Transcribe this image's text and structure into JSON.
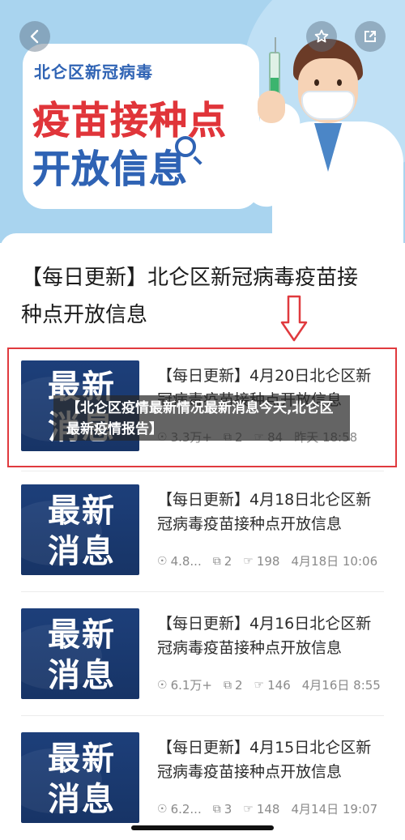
{
  "banner": {
    "subtitle": "北仑区新冠病毒",
    "headline_line1": "疫苗接种点",
    "headline_line2": "开放信息",
    "colors": {
      "background": "#a9d4ef",
      "red": "#e0353a",
      "blue": "#2f63b4"
    }
  },
  "nav": {
    "back_icon": "chevron-left-icon",
    "favorite_icon": "star-icon",
    "share_icon": "share-icon"
  },
  "article": {
    "title": "【每日更新】北仑区新冠病毒疫苗接种点开放信息"
  },
  "items": [
    {
      "thumb_text": "最新消息",
      "title": "【每日更新】4月20日北仑区新冠病毒疫苗接种点开放信息",
      "views": "3.3万+",
      "shares": "2",
      "likes": "84",
      "date": "昨天 18:58"
    },
    {
      "thumb_text": "最新消息",
      "title": "【每日更新】4月18日北仑区新冠病毒疫苗接种点开放信息",
      "views": "4.8...",
      "shares": "2",
      "likes": "198",
      "date": "4月18日 10:06"
    },
    {
      "thumb_text": "最新消息",
      "title": "【每日更新】4月16日北仑区新冠病毒疫苗接种点开放信息",
      "views": "6.1万+",
      "shares": "2",
      "likes": "146",
      "date": "4月16日 8:55"
    },
    {
      "thumb_text": "最新消息",
      "title": "【每日更新】4月15日北仑区新冠病毒疫苗接种点开放信息",
      "views": "6.2...",
      "shares": "3",
      "likes": "148",
      "date": "4月14日 19:07"
    }
  ],
  "overlay": {
    "caption": "【北仑区疫情最新情况最新消息今天,北仑区最新疫情报告】"
  }
}
